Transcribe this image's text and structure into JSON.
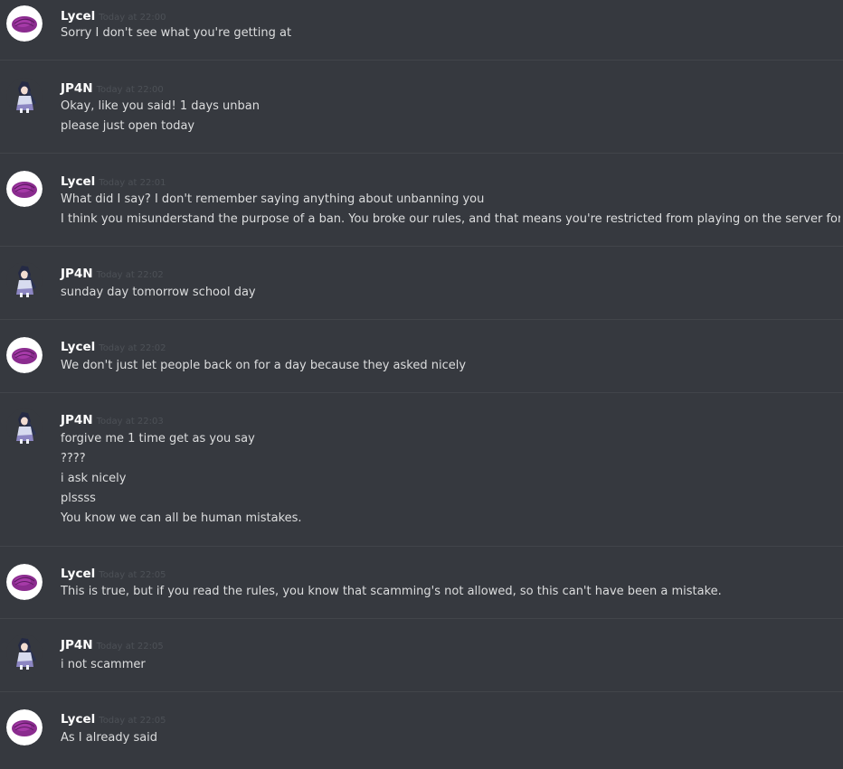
{
  "messages": [
    {
      "author": "Lycel",
      "timestamp": "Today at 22:00",
      "avatar": "lycel-avatar",
      "lines": [
        "Sorry I don't see what you're getting at"
      ]
    },
    {
      "author": "JP4N",
      "timestamp": "Today at 22:00",
      "avatar": "jp4n-avatar",
      "lines": [
        "Okay, like you said! 1 days unban",
        "please just open today"
      ]
    },
    {
      "author": "Lycel",
      "timestamp": "Today at 22:01",
      "avatar": "lycel-avatar",
      "lines": [
        "What did I say? I don't remember saying anything about unbanning you",
        "I think you misunderstand the purpose of a ban. You broke our rules, and that means you're restricted from playing on the server for a time"
      ]
    },
    {
      "author": "JP4N",
      "timestamp": "Today at 22:02",
      "avatar": "jp4n-avatar",
      "lines": [
        "sunday day tomorrow school day"
      ]
    },
    {
      "author": "Lycel",
      "timestamp": "Today at 22:02",
      "avatar": "lycel-avatar",
      "lines": [
        "We don't just let people back on for a day because they asked nicely"
      ]
    },
    {
      "author": "JP4N",
      "timestamp": "Today at 22:03",
      "avatar": "jp4n-avatar",
      "lines": [
        "forgive me 1 time get as you say",
        "????",
        "i ask nicely",
        "plssss",
        "You know we can all be human mistakes."
      ]
    },
    {
      "author": "Lycel",
      "timestamp": "Today at 22:05",
      "avatar": "lycel-avatar",
      "lines": [
        "This is true, but if you read the rules, you know that scamming's not allowed, so this can't have been a mistake."
      ]
    },
    {
      "author": "JP4N",
      "timestamp": "Today at 22:05",
      "avatar": "jp4n-avatar",
      "lines": [
        "i not scammer"
      ]
    },
    {
      "author": "Lycel",
      "timestamp": "Today at 22:05",
      "avatar": "lycel-avatar",
      "lines": [
        "As I already said"
      ]
    }
  ],
  "colors": {
    "background": "#36393f",
    "author": "#ffffff",
    "text": "#dcddde",
    "timestamp": "#4d5157",
    "divider": "#42454a"
  }
}
